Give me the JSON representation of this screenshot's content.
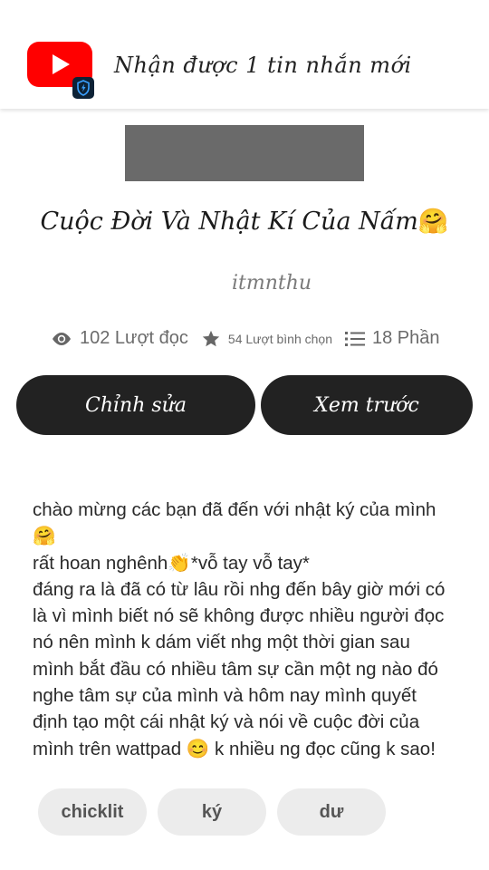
{
  "notification": {
    "app_icon": "youtube-icon",
    "badge_icon": "shield-icon",
    "text": "Nhận được 1 tin nhắn mới"
  },
  "story": {
    "title": "Cuộc Đời Và Nhật Kí Của Nấm",
    "title_emoji": "🤗",
    "author": "itmnthu",
    "stats": {
      "reads": "102 Lượt đọc",
      "votes": "54 Lượt bình chọn",
      "parts": "18 Phần"
    },
    "buttons": {
      "edit": "Chỉnh sửa",
      "preview": "Xem trước"
    },
    "description": [
      "chào mừng các bạn đã đến với nhật ký của mình",
      "🤗",
      "rất hoan nghênh👏*vỗ tay vỗ tay*",
      "đáng ra là đã có từ lâu rồi nhg đến bây giờ mới có",
      "là vì mình biết nó sẽ không được nhiều người đọc",
      "nó nên mình k dám viết nhg một thời gian sau",
      "mình bắt đầu có nhiều tâm sự cần một ng nào đó",
      "nghe tâm sự của mình và hôm nay mình quyết",
      "định tạo một cái nhật ký và nói về cuộc đời của",
      "mình trên wattpad 😊 k nhiều ng đọc cũng k sao!"
    ],
    "tags": [
      "chicklit",
      "ký",
      "dư"
    ]
  },
  "colors": {
    "youtube_red": "#ff0000",
    "button_bg": "#222222",
    "tag_bg": "#ececec",
    "cover_gray": "#6a6a6a"
  }
}
